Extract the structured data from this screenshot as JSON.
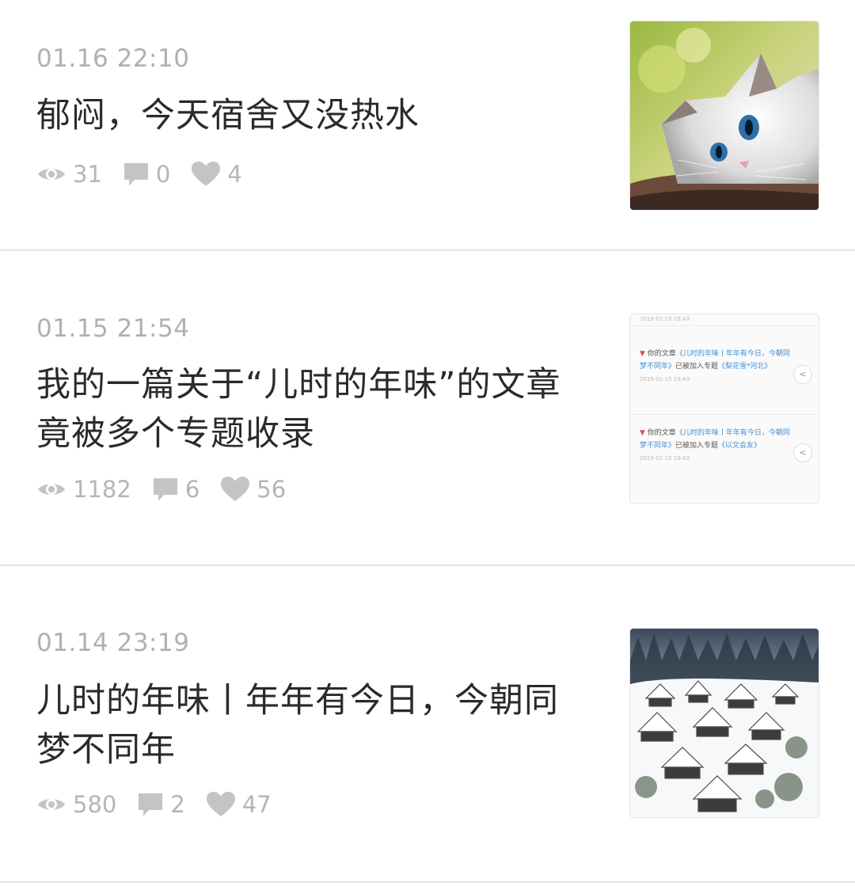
{
  "posts": [
    {
      "time": "01.16 22:10",
      "title": "郁闷，今天宿舍又没热水",
      "views": "31",
      "comments": "0",
      "likes": "4",
      "thumbnail": "cat-photo"
    },
    {
      "time": "01.15 21:54",
      "title": "我的一篇关于“儿时的年味”的文章竟被多个专题收录",
      "views": "1182",
      "comments": "6",
      "likes": "56",
      "thumbnail": "notification-screenshot",
      "thumb_text": {
        "top_time": "2019-01-15 19:43",
        "notice1_prefix": "你的文章",
        "notice1_link": "《儿时的年味丨年年有今日，今朝同梦不同年》",
        "notice1_mid": "已被加入专题",
        "notice1_topic": "《梨花雪*河北》",
        "notice1_time": "2019-01-15 19:43",
        "notice2_prefix": "你的文章",
        "notice2_link": "《儿时的年味丨年年有今日，今朝同梦不同年》",
        "notice2_mid": "已被加入专题",
        "notice2_topic": "《以文会友》",
        "notice2_time": "2019-01-15 19:43"
      }
    },
    {
      "time": "01.14 23:19",
      "title": "儿时的年味丨年年有今日，今朝同梦不同年",
      "views": "580",
      "comments": "2",
      "likes": "47",
      "thumbnail": "snowy-village-photo"
    }
  ],
  "icons": {
    "views": "eye-icon",
    "comments": "comment-icon",
    "likes": "heart-icon"
  },
  "colors": {
    "meta_gray": "#b0b0b0",
    "title": "#2a2a2a",
    "divider": "#e6e6e6",
    "link_blue": "#3f8fd6"
  }
}
